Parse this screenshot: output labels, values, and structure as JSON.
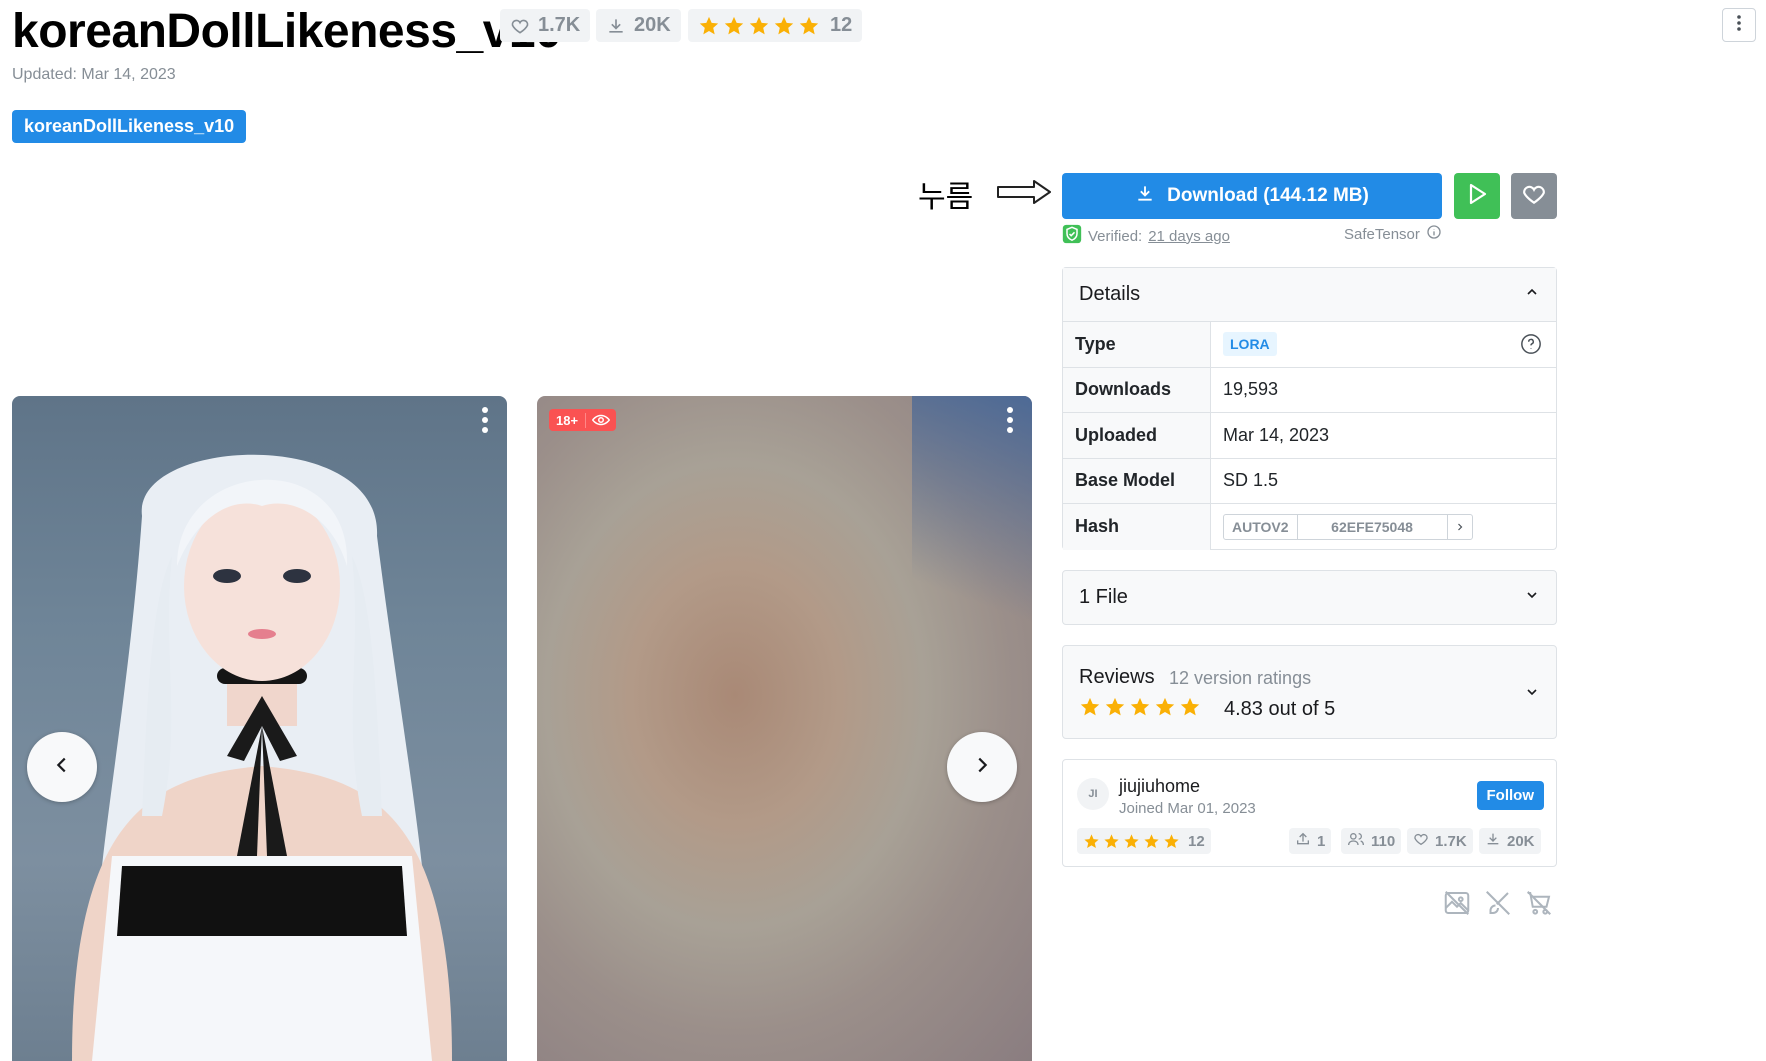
{
  "model": {
    "title": "koreanDollLikeness_v10",
    "likes": "1.7K",
    "downloads": "20K",
    "rating_count": "12",
    "updated": "Updated: Mar 14, 2023",
    "version_tab": "koreanDollLikeness_v10"
  },
  "annotation": {
    "text": "누름"
  },
  "actions": {
    "download_label": "Download (144.12 MB)",
    "verified_label": "Verified:",
    "verified_when": "21 days ago",
    "format": "SafeTensor"
  },
  "details": {
    "heading": "Details",
    "rows": [
      {
        "label": "Type",
        "value": "LORA"
      },
      {
        "label": "Downloads",
        "value": "19,593"
      },
      {
        "label": "Uploaded",
        "value": "Mar 14, 2023"
      },
      {
        "label": "Base Model",
        "value": "SD 1.5"
      },
      {
        "label": "Hash",
        "value": "62EFE75048",
        "hash_type": "AUTOV2"
      }
    ]
  },
  "files": {
    "heading": "1 File"
  },
  "reviews": {
    "heading": "Reviews",
    "subtitle": "12 version ratings",
    "score": "4.83 out of 5",
    "stars": 5
  },
  "creator": {
    "initials": "JI",
    "name": "jiujiuhome",
    "joined": "Joined Mar 01, 2023",
    "follow_label": "Follow",
    "rating_count": "12",
    "uploads": "1",
    "followers": "110",
    "likes": "1.7K",
    "downloads": "20K"
  },
  "gallery": {
    "nsfw_label": "18+"
  },
  "colors": {
    "primary": "#228be6",
    "success": "#40c057",
    "star": "#fab005",
    "danger": "#fa5252",
    "muted": "#868e96"
  }
}
